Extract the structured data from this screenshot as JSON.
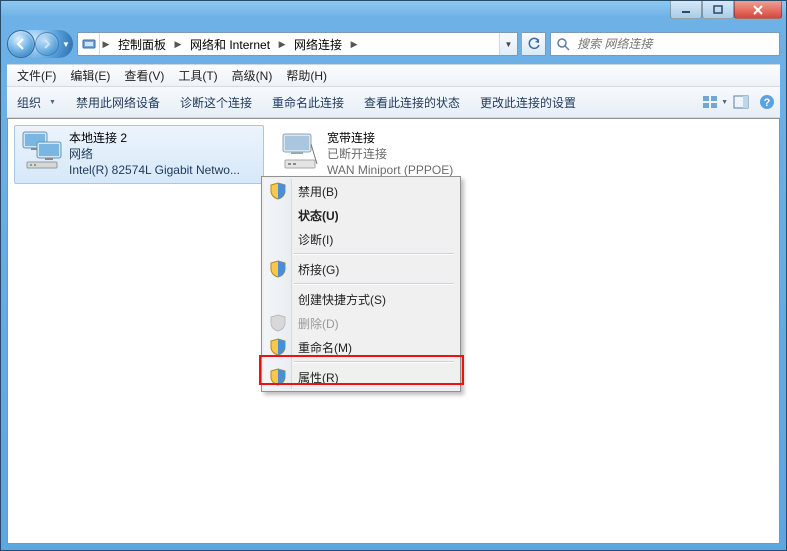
{
  "window_controls": {
    "min": "minimize",
    "max": "maximize",
    "close": "close"
  },
  "breadcrumb": {
    "items": [
      "控制面板",
      "网络和 Internet",
      "网络连接"
    ]
  },
  "search": {
    "placeholder": "搜索 网络连接"
  },
  "menu": {
    "file": "文件(F)",
    "edit": "编辑(E)",
    "view": "查看(V)",
    "tools": "工具(T)",
    "advanced": "高级(N)",
    "help": "帮助(H)"
  },
  "toolbar": {
    "organize": "组织",
    "disable": "禁用此网络设备",
    "diagnose": "诊断这个连接",
    "rename": "重命名此连接",
    "status": "查看此连接的状态",
    "change": "更改此连接的设置"
  },
  "connections": [
    {
      "name": "本地连接 2",
      "status": "网络",
      "adapter": "Intel(R) 82574L Gigabit Netwo...",
      "selected": true
    },
    {
      "name": "宽带连接",
      "status": "已断开连接",
      "adapter": "WAN Miniport (PPPOE)",
      "selected": false
    }
  ],
  "context_menu": {
    "disable": "禁用(B)",
    "status": "状态(U)",
    "diagnose": "诊断(I)",
    "bridge": "桥接(G)",
    "shortcut": "创建快捷方式(S)",
    "delete": "删除(D)",
    "rename": "重命名(M)",
    "properties": "属性(R)"
  }
}
